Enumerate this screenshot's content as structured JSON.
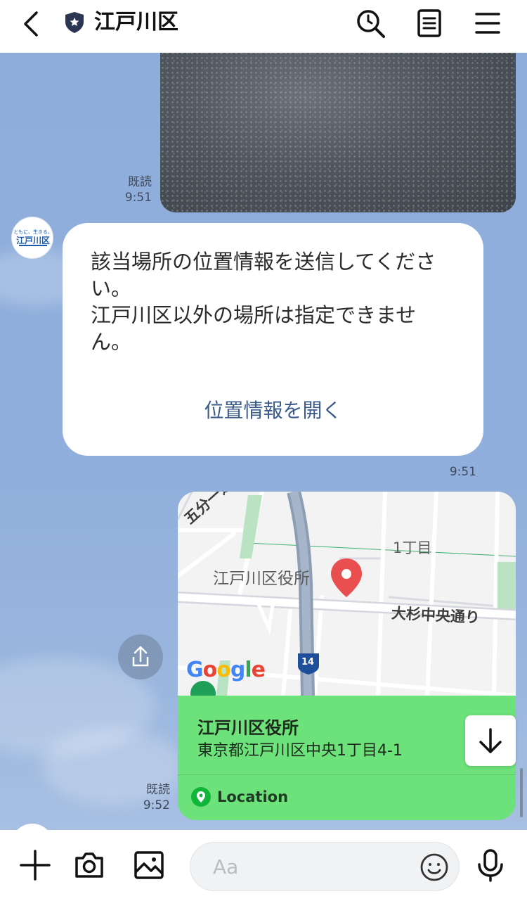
{
  "header": {
    "title": "江戸川区",
    "icons": [
      "back-icon",
      "shield-star-icon",
      "search-icon",
      "notes-icon",
      "menu-icon"
    ]
  },
  "messages": [
    {
      "type": "photo",
      "direction": "outgoing",
      "read_label": "既読",
      "time": "9:51"
    },
    {
      "type": "text",
      "direction": "incoming",
      "lines": [
        "該当場所の位置情報を送信してくださ",
        "い。",
        "江戸川区以外の場所は指定できませ",
        "ん。"
      ],
      "link_label": "位置情報を開く",
      "time": "9:51"
    },
    {
      "type": "location",
      "direction": "outgoing",
      "read_label": "既読",
      "time": "9:52",
      "place_name": "江戸川区役所",
      "address": "東京都江戸川区中央1丁目4-1",
      "tag": "Location",
      "map": {
        "labels": [
          "五分一通り",
          "1丁目",
          "江戸川区役所",
          "大杉中央通り",
          "14"
        ],
        "google": [
          "G",
          "o",
          "o",
          "g",
          "l",
          "e"
        ]
      }
    }
  ],
  "input": {
    "placeholder": "Aa"
  },
  "colors": {
    "accent_green": "#6de27a",
    "chat_bg": "#8faedb",
    "link_blue": "#3a5a8a",
    "pin_red": "#ea4f4f"
  }
}
